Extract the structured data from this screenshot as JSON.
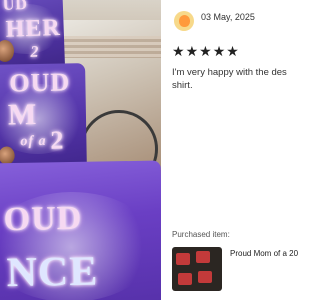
{
  "photo": {
    "alt_texts": {
      "shirt_top_line1": "UD",
      "shirt_top_line2": "HER",
      "shirt_top_line3": "2",
      "shirt_mid_line1": "OUD",
      "shirt_mid_line2": "M",
      "shirt_mid_line3": "of a",
      "shirt_mid_line4": "2",
      "shirt_front_line1": "OUD",
      "shirt_front_line2": "NCE"
    },
    "colors": {
      "shirt": "#6a3fc4",
      "print": "#f6d9f2"
    }
  },
  "review": {
    "date": "03 May, 2025",
    "rating": 5,
    "stars": [
      "★",
      "★",
      "★",
      "★",
      "★"
    ],
    "text_line1": "I'm very happy with the des",
    "text_line2": "shirt.",
    "purchased_label": "Purchased item:",
    "item_name": "Proud Mom of a 20"
  }
}
